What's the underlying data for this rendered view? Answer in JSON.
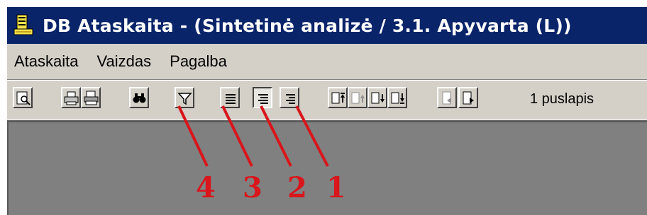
{
  "window": {
    "title": "DB Ataskaita - (Sintetinė analizė / 3.1. Apyvarta  (L))"
  },
  "menu": {
    "items": [
      "Ataskaita",
      "Vaizdas",
      "Pagalba"
    ]
  },
  "toolbar": {
    "buttons": [
      "preview-icon",
      "print-icon",
      "print-setup-icon",
      "find-icon",
      "filter-icon",
      "align-full-icon",
      "align-center-icon",
      "align-right-icon",
      "first-page-icon",
      "prev-page-icon",
      "next-page-icon",
      "last-page-icon",
      "page-back-icon",
      "page-forward-icon"
    ],
    "page_count_label": "1 puslapis"
  },
  "annotations": {
    "labels": [
      "4",
      "3",
      "2",
      "1"
    ],
    "color": "#d8161c"
  },
  "colors": {
    "titlebar": "#0a246a",
    "chrome": "#d4d0c8",
    "workspace": "#808080"
  }
}
